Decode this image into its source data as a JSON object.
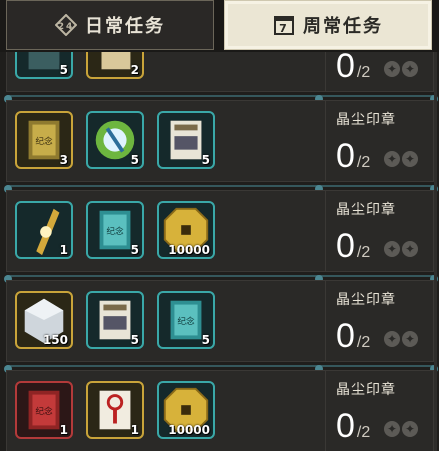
{
  "tabs": {
    "daily": {
      "label": "日常任务",
      "icon": "daily-emblem-icon"
    },
    "weekly": {
      "label": "周常任务",
      "icon": "calendar-7-icon"
    }
  },
  "rows": [
    {
      "reward_label": "",
      "count": "0",
      "total": "/2",
      "items": [
        {
          "icon": "photo-album-icon",
          "quantity": "5",
          "frame": "teal"
        },
        {
          "icon": "book-icon",
          "quantity": "2",
          "frame": "gold"
        }
      ]
    },
    {
      "reward_label": "晶尘印章",
      "count": "0",
      "total": "/2",
      "items": [
        {
          "icon": "golden-album-icon",
          "quantity": "3",
          "frame": "gold"
        },
        {
          "icon": "energy-crystal-icon",
          "quantity": "5",
          "frame": "teal"
        },
        {
          "icon": "guide-book-icon",
          "quantity": "5",
          "frame": "teal"
        }
      ]
    },
    {
      "reward_label": "晶尘印章",
      "count": "0",
      "total": "/2",
      "items": [
        {
          "icon": "golden-scroll-icon",
          "quantity": "1",
          "frame": "teal"
        },
        {
          "icon": "teal-album-icon",
          "quantity": "5",
          "frame": "teal"
        },
        {
          "icon": "gold-coin-icon",
          "quantity": "10000",
          "frame": "teal"
        }
      ]
    },
    {
      "reward_label": "晶尘印章",
      "count": "0",
      "total": "/2",
      "items": [
        {
          "icon": "crystal-cube-icon",
          "quantity": "150",
          "frame": "gold"
        },
        {
          "icon": "guide-book-icon",
          "quantity": "5",
          "frame": "teal"
        },
        {
          "icon": "teal-album-icon",
          "quantity": "5",
          "frame": "teal"
        }
      ]
    },
    {
      "reward_label": "晶尘印章",
      "count": "0",
      "total": "/2",
      "items": [
        {
          "icon": "red-album-icon",
          "quantity": "1",
          "frame": "red"
        },
        {
          "icon": "red-key-icon",
          "quantity": "1",
          "frame": "gold"
        },
        {
          "icon": "gold-coin-icon",
          "quantity": "10000",
          "frame": "teal"
        }
      ]
    }
  ]
}
